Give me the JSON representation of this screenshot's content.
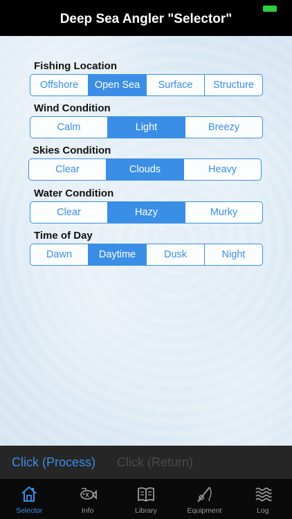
{
  "nav": {
    "title": "Deep Sea Angler \"Selector\""
  },
  "sections": [
    {
      "label": "Fishing Location",
      "options": [
        "Offshore",
        "Open Sea",
        "Surface",
        "Structure"
      ],
      "selected": 1
    },
    {
      "label": "Wind Condition",
      "options": [
        "Calm",
        "Light",
        "Breezy"
      ],
      "selected": 1
    },
    {
      "label": "Skies Condition",
      "options": [
        "Clear",
        "Clouds",
        "Heavy"
      ],
      "selected": 1
    },
    {
      "label": "Water Condition",
      "options": [
        "Clear",
        "Hazy",
        "Murky"
      ],
      "selected": 1
    },
    {
      "label": "Time of Day",
      "options": [
        "Dawn",
        "Daytime",
        "Dusk",
        "Night"
      ],
      "selected": 1
    }
  ],
  "actions": {
    "process_label": "Click (Process)",
    "return_label": "Click (Return)"
  },
  "tabs": [
    {
      "label": "Selector",
      "icon": "home-icon",
      "active": true
    },
    {
      "label": "Info",
      "icon": "fish-icon",
      "active": false
    },
    {
      "label": "Library",
      "icon": "book-icon",
      "active": false
    },
    {
      "label": "Equipment",
      "icon": "fishing-rod-icon",
      "active": false
    },
    {
      "label": "Log",
      "icon": "waves-icon",
      "active": false
    }
  ],
  "colors": {
    "accent": "#3a8ee6",
    "battery": "#2ecc40",
    "tab_inactive": "#9a9a9a",
    "disabled": "#4a4a4a"
  }
}
